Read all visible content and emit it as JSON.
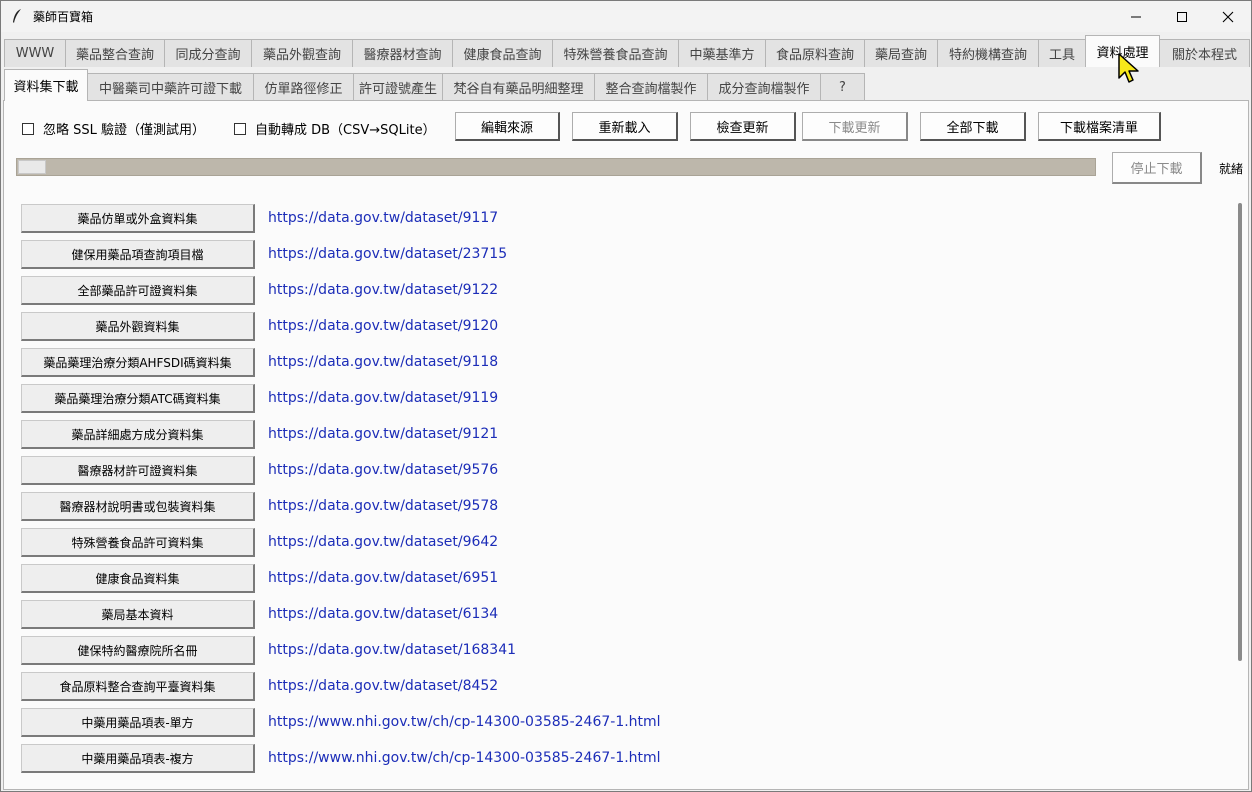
{
  "window": {
    "title": "藥師百寶箱",
    "minimize_icon": "minimize-icon",
    "maximize_icon": "maximize-icon",
    "close_icon": "close-icon"
  },
  "main_tabs": [
    {
      "label": "WWW"
    },
    {
      "label": "藥品整合查詢"
    },
    {
      "label": "同成分查詢"
    },
    {
      "label": "藥品外觀查詢"
    },
    {
      "label": "醫療器材查詢"
    },
    {
      "label": "健康食品查詢"
    },
    {
      "label": "特殊營養食品查詢"
    },
    {
      "label": "中藥基準方"
    },
    {
      "label": "食品原料查詢"
    },
    {
      "label": "藥局查詢"
    },
    {
      "label": "特約機構查詢"
    },
    {
      "label": "工具"
    },
    {
      "label": "資料處理",
      "active": true
    },
    {
      "label": "關於本程式"
    }
  ],
  "sub_tabs": [
    {
      "label": "資料集下載",
      "active": true
    },
    {
      "label": "中醫藥司中藥許可證下載"
    },
    {
      "label": "仿單路徑修正"
    },
    {
      "label": "許可證號產生"
    },
    {
      "label": "梵谷自有藥品明細整理"
    },
    {
      "label": "整合查詢檔製作"
    },
    {
      "label": "成分查詢檔製作"
    },
    {
      "label": "?"
    }
  ],
  "toolbar": {
    "ignore_ssl": "忽略 SSL 驗證（僅測試用）",
    "auto_db": "自動轉成 DB（CSV→SQLite）",
    "edit_source": "編輯來源",
    "reload": "重新載入",
    "check_update": "檢查更新",
    "download_update": "下載更新",
    "download_all": "全部下載",
    "download_list": "下載檔案清單"
  },
  "progress": {
    "value": 0.026,
    "stop_label": "停止下載",
    "status": "就緒"
  },
  "datasets": [
    {
      "name": "藥品仿單或外盒資料集",
      "url": "https://data.gov.tw/dataset/9117"
    },
    {
      "name": "健保用藥品項查詢項目檔",
      "url": "https://data.gov.tw/dataset/23715"
    },
    {
      "name": "全部藥品許可證資料集",
      "url": "https://data.gov.tw/dataset/9122"
    },
    {
      "name": "藥品外觀資料集",
      "url": "https://data.gov.tw/dataset/9120"
    },
    {
      "name": "藥品藥理治療分類AHFSDI碼資料集",
      "url": "https://data.gov.tw/dataset/9118"
    },
    {
      "name": "藥品藥理治療分類ATC碼資料集",
      "url": "https://data.gov.tw/dataset/9119"
    },
    {
      "name": "藥品詳細處方成分資料集",
      "url": "https://data.gov.tw/dataset/9121"
    },
    {
      "name": "醫療器材許可證資料集",
      "url": "https://data.gov.tw/dataset/9576"
    },
    {
      "name": "醫療器材說明書或包裝資料集",
      "url": "https://data.gov.tw/dataset/9578"
    },
    {
      "name": "特殊營養食品許可資料集",
      "url": "https://data.gov.tw/dataset/9642"
    },
    {
      "name": "健康食品資料集",
      "url": "https://data.gov.tw/dataset/6951"
    },
    {
      "name": "藥局基本資料",
      "url": "https://data.gov.tw/dataset/6134"
    },
    {
      "name": "健保特約醫療院所名冊",
      "url": "https://data.gov.tw/dataset/168341"
    },
    {
      "name": "食品原料整合查詢平臺資料集",
      "url": "https://data.gov.tw/dataset/8452"
    },
    {
      "name": "中藥用藥品項表-單方",
      "url": "https://www.nhi.gov.tw/ch/cp-14300-03585-2467-1.html"
    },
    {
      "name": "中藥用藥品項表-複方",
      "url": "https://www.nhi.gov.tw/ch/cp-14300-03585-2467-1.html"
    }
  ]
}
